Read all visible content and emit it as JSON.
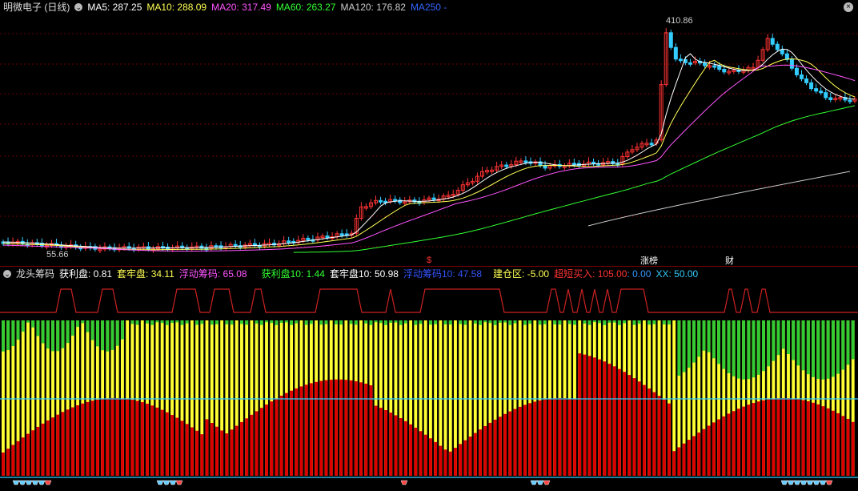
{
  "title": "明微电子 (日线)",
  "ma": [
    {
      "label": "MA5: 287.25",
      "color": "#ffffff"
    },
    {
      "label": "MA10: 288.09",
      "color": "#ffff55"
    },
    {
      "label": "MA20: 317.49",
      "color": "#ff55ff"
    },
    {
      "label": "MA60: 263.27",
      "color": "#33ff33"
    },
    {
      "label": "MA120: 176.82",
      "color": "#cccccc"
    },
    {
      "label": "MA250 -",
      "color": "#3366ff"
    }
  ],
  "price_high_label": "410.86",
  "price_low_label": "55.66",
  "event_markers": [
    {
      "label": "$",
      "color": "#ff3333"
    },
    {
      "label": "涨榜",
      "color": "#ffffff"
    },
    {
      "label": "财",
      "color": "#ffffff"
    }
  ],
  "indicator": {
    "name": "龙头筹码",
    "fields": [
      {
        "label": "获利盘: 0.81",
        "color": "#ffffff"
      },
      {
        "label": "套牢盘: 34.11",
        "color": "#ffff55"
      },
      {
        "label": "浮动筹码: 65.08",
        "color": "#ff55ff"
      },
      {
        "label": "获利盘10: 1.44",
        "color": "#33ff33"
      },
      {
        "label": "套牢盘10: 50.98",
        "color": "#ffffff"
      },
      {
        "label": "浮动筹码10: 47.58",
        "color": "#3355ff"
      },
      {
        "label": "建仓区: -5.00",
        "color": "#ffff55"
      },
      {
        "label": "超短买入: 105.00",
        "color": "#ff3333"
      },
      {
        "label": ": 0.00",
        "color": "#3399ff"
      },
      {
        "label": "XX: 50.00",
        "color": "#33ccff"
      }
    ]
  },
  "colors": {
    "up": "#ff3333",
    "down": "#33ccff",
    "profit": "#ff0000",
    "trapped": "#ffff33",
    "float": "#33cc33"
  }
}
